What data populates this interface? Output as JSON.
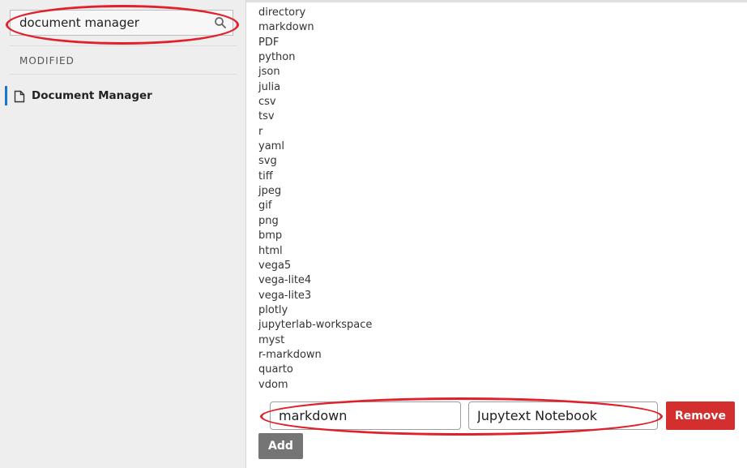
{
  "search": {
    "value": "document manager",
    "icon": "search-icon"
  },
  "sidebar": {
    "section_header": "MODIFIED",
    "items": [
      {
        "label": "Document Manager",
        "icon": "document-icon",
        "active": true
      }
    ]
  },
  "main": {
    "file_types": [
      "directory",
      "markdown",
      "PDF",
      "python",
      "json",
      "julia",
      "csv",
      "tsv",
      "r",
      "yaml",
      "svg",
      "tiff",
      "jpeg",
      "gif",
      "png",
      "bmp",
      "html",
      "vega5",
      "vega-lite4",
      "vega-lite3",
      "plotly",
      "jupyterlab-workspace",
      "myst",
      "r-markdown",
      "quarto",
      "vdom"
    ],
    "entry": {
      "file_type": "markdown",
      "factory": "Jupytext Notebook",
      "remove_label": "Remove"
    },
    "add_label": "Add"
  },
  "colors": {
    "remove_button": "#d32f2f",
    "add_button": "#757575",
    "active_indicator": "#1976d2",
    "annotation": "#e0202a",
    "sidebar_bg": "#eeeeee"
  }
}
